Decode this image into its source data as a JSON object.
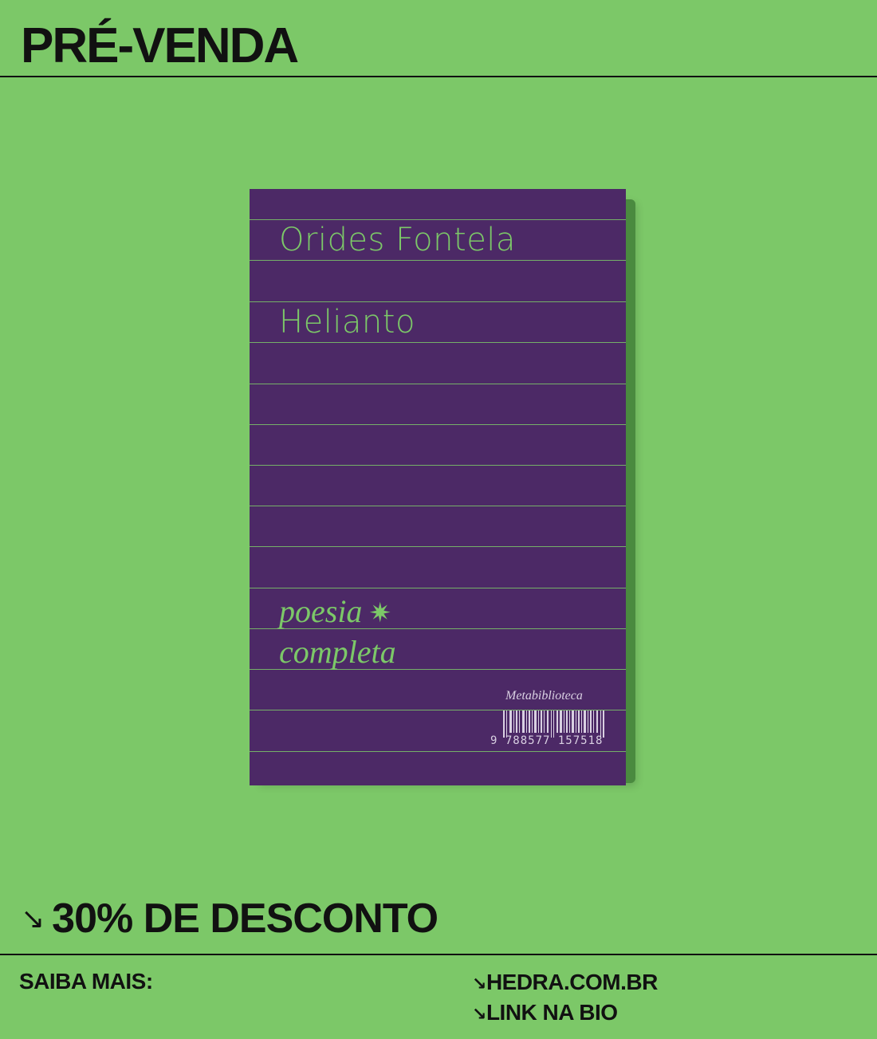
{
  "header": {
    "title": "PRÉ-VENDA"
  },
  "book": {
    "author": "Orides Fontela",
    "title": "Helianto",
    "subtitle_line1": "poesia",
    "subtitle_line2": "completa",
    "star_glyph": "✷",
    "imprint": "Metabiblioteca",
    "isbn": "9 788577 157518",
    "cover_color": "#4c2966",
    "text_color": "#7cc868"
  },
  "promo": {
    "arrow": "↘",
    "discount": "30% DE DESCONTO"
  },
  "footer": {
    "more_label": "SAIBA MAIS:",
    "links": [
      {
        "arrow": "↘",
        "label": "HEDRA.COM.BR"
      },
      {
        "arrow": "↘",
        "label": "LINK NA BIO"
      }
    ]
  },
  "colors": {
    "background": "#7cc868",
    "ink": "#111111"
  }
}
